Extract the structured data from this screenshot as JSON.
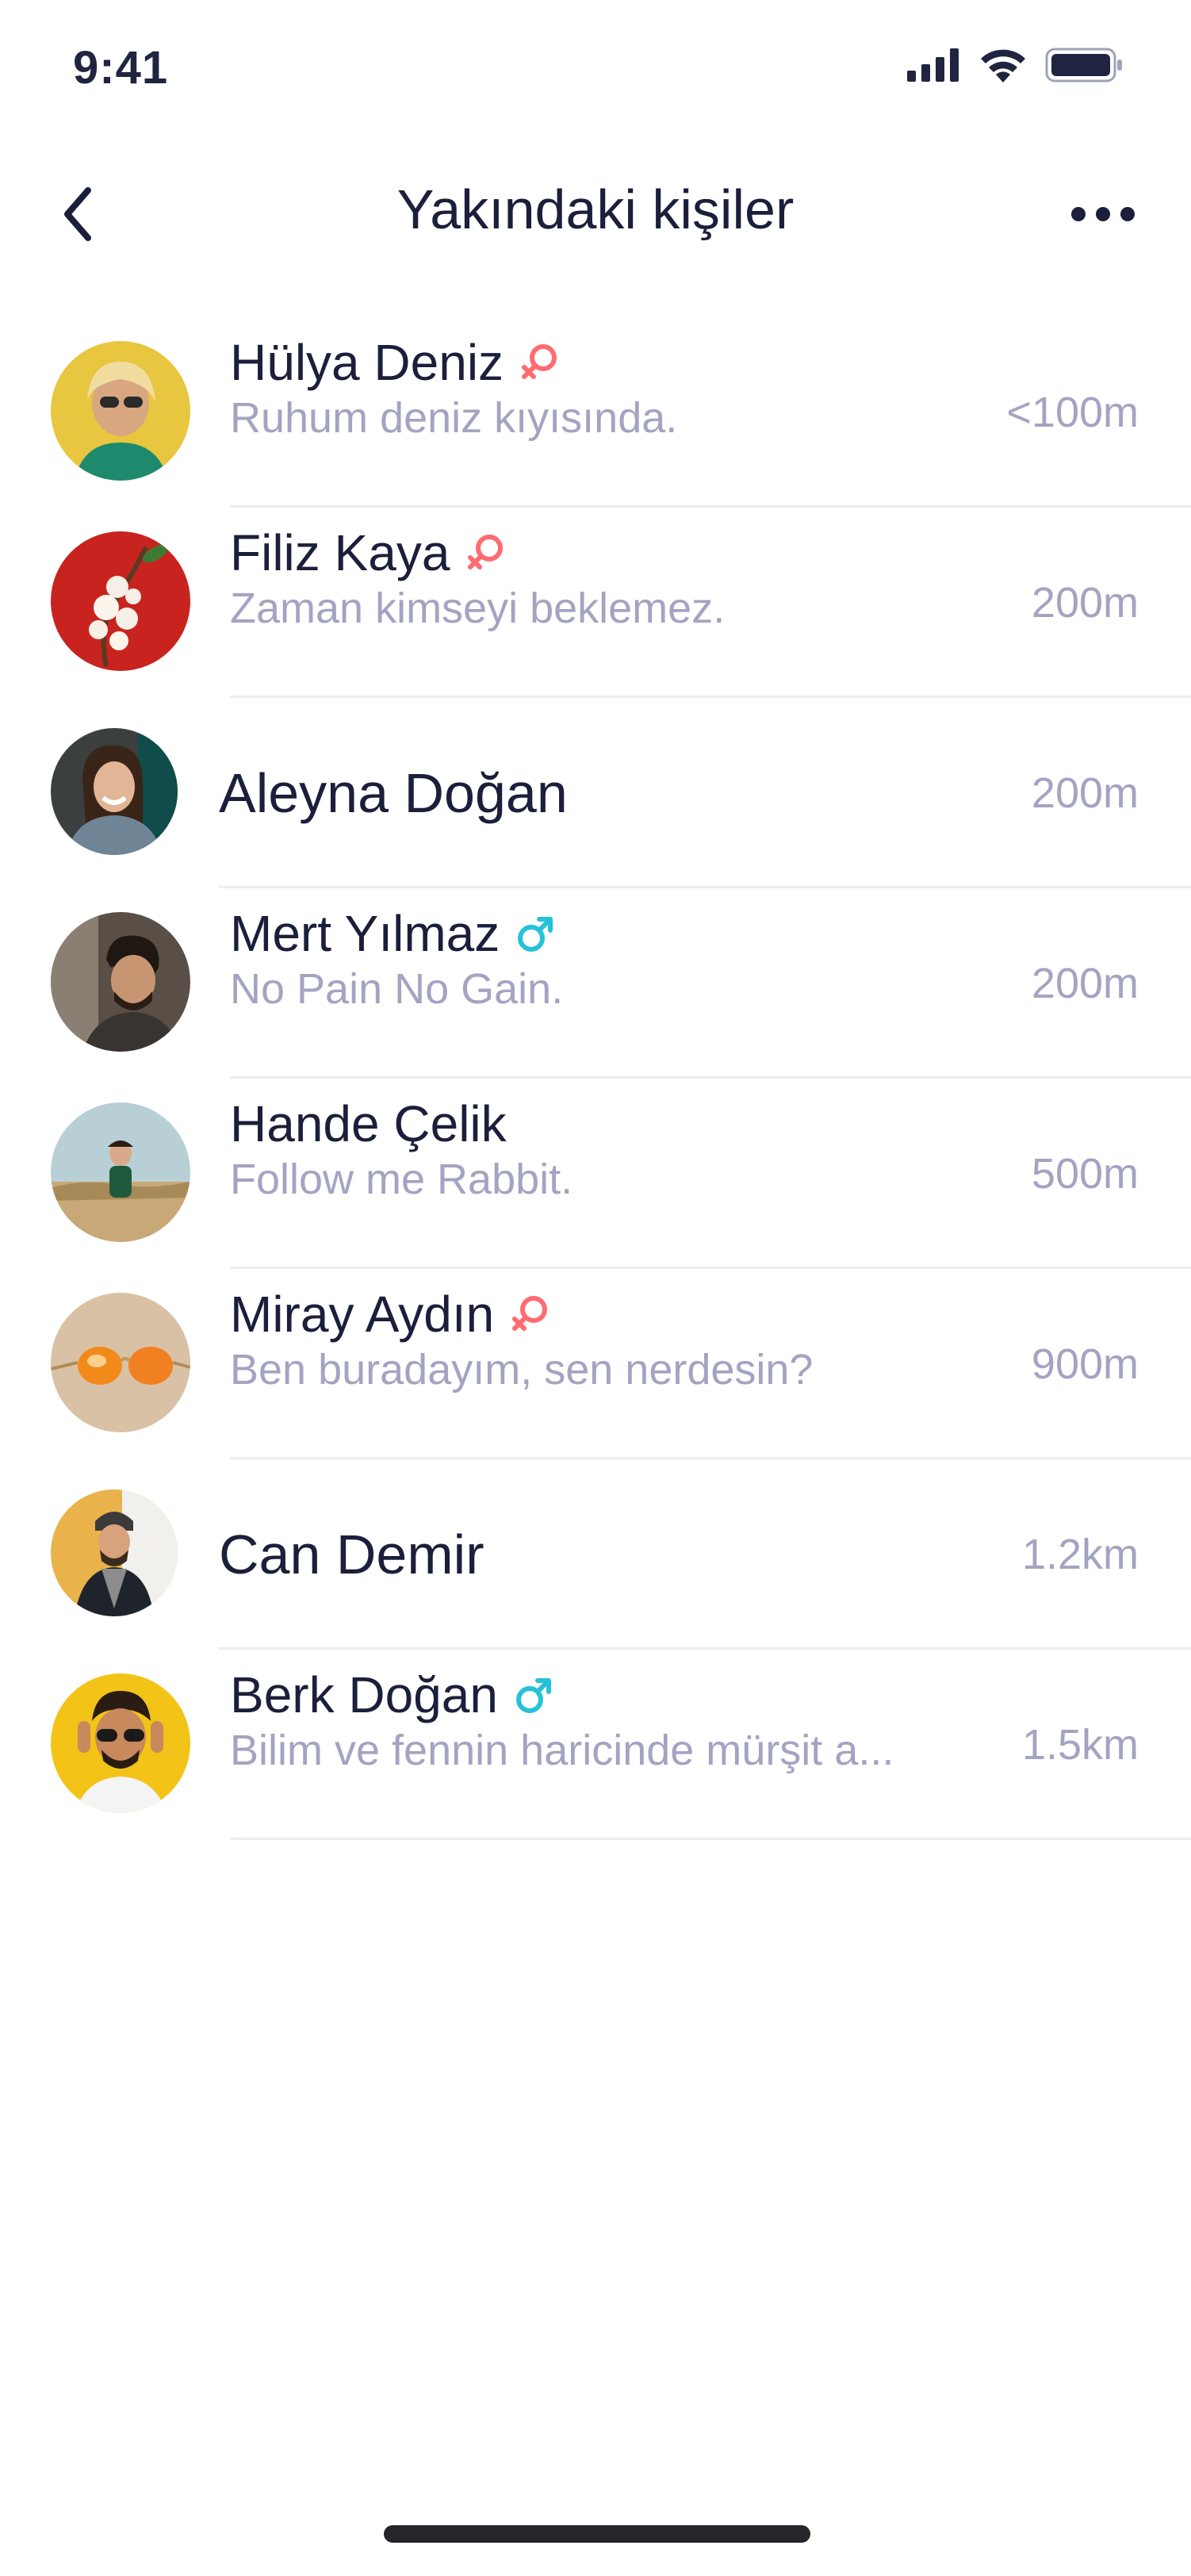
{
  "status_bar": {
    "time": "9:41"
  },
  "header": {
    "title": "Yakındaki kişiler"
  },
  "colors": {
    "female": "#ff6b72",
    "male": "#25c2d9",
    "muted": "#a3a3c2",
    "text": "#1b1f3b"
  },
  "people": [
    {
      "name": "Hülya Deniz",
      "gender": "female-icon",
      "status": "Ruhum deniz kıyısında.",
      "distance": "<100m"
    },
    {
      "name": "Filiz Kaya",
      "gender": "female-icon",
      "status": "Zaman kimseyi beklemez.",
      "distance": "200m"
    },
    {
      "name": "Aleyna Doğan",
      "gender": "",
      "status": "",
      "distance": "200m"
    },
    {
      "name": "Mert Yılmaz",
      "gender": "male-icon",
      "status": "No Pain No Gain.",
      "distance": "200m"
    },
    {
      "name": "Hande Çelik",
      "gender": "",
      "status": "Follow me Rabbit.",
      "distance": "500m"
    },
    {
      "name": "Miray Aydın",
      "gender": "female-icon",
      "status": "Ben buradayım, sen nerdesin?",
      "distance": "900m"
    },
    {
      "name": "Can Demir",
      "gender": "",
      "status": "",
      "distance": "1.2km"
    },
    {
      "name": "Berk Doğan",
      "gender": "male-icon",
      "status": "Bilim ve fennin haricinde mürşit a...",
      "distance": "1.5km"
    }
  ]
}
